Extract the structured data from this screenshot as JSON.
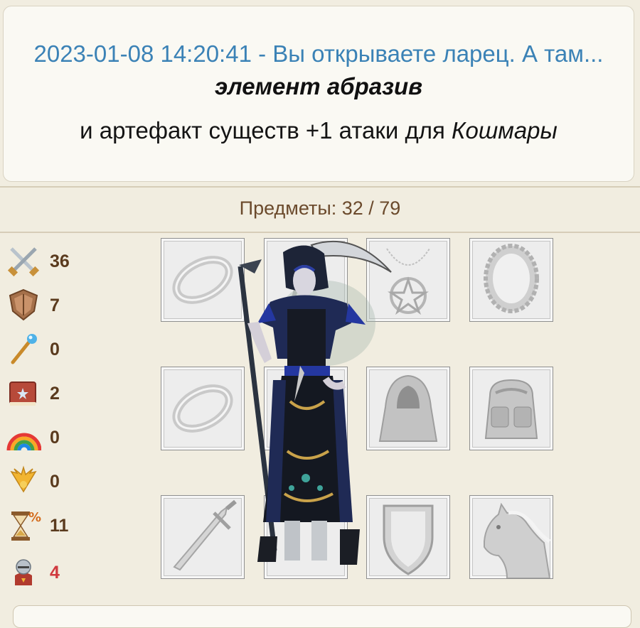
{
  "message": {
    "timestamp": "2023-01-08 14:20:41",
    "text_prefix": " - Вы открываете ларец. А там...",
    "item_name": "элемент абразив",
    "line2_prefix": "и артефакт существ +1 атаки для",
    "creature_name": "Кошмары"
  },
  "inventory": {
    "label": "Предметы:",
    "count": "32 / 79"
  },
  "stats": [
    {
      "icon": "crossed-swords-icon",
      "value": "36"
    },
    {
      "icon": "shield-icon",
      "value": "7"
    },
    {
      "icon": "magic-wand-icon",
      "value": "0"
    },
    {
      "icon": "spellbook-icon",
      "value": "2"
    },
    {
      "icon": "rainbow-icon",
      "value": "0"
    },
    {
      "icon": "golden-wings-icon",
      "value": "0"
    },
    {
      "icon": "hourglass-percent-icon",
      "value": "11"
    },
    {
      "icon": "knight-icon",
      "value": "4",
      "color": "#d0393e"
    }
  ],
  "slots": [
    {
      "name": "ring-slot-1",
      "icon": "ring-icon"
    },
    {
      "name": "weapon-slot",
      "icon": "scythe-icon"
    },
    {
      "name": "amulet-slot",
      "icon": "pentagram-amulet-icon"
    },
    {
      "name": "mirror-slot",
      "icon": "mirror-icon"
    },
    {
      "name": "ring-slot-2",
      "icon": "ring-icon"
    },
    {
      "name": "armor-slot",
      "icon": "armor-icon"
    },
    {
      "name": "cloak-slot",
      "icon": "hooded-cloak-icon"
    },
    {
      "name": "bag-slot",
      "icon": "backpack-icon"
    },
    {
      "name": "sword-slot",
      "icon": "sword-icon"
    },
    {
      "name": "boots-slot",
      "icon": "boots-icon"
    },
    {
      "name": "shield-slot",
      "icon": "shield-icon"
    },
    {
      "name": "horse-slot",
      "icon": "horse-icon"
    }
  ],
  "hero": {
    "icon": "hero-reaper-figure"
  }
}
